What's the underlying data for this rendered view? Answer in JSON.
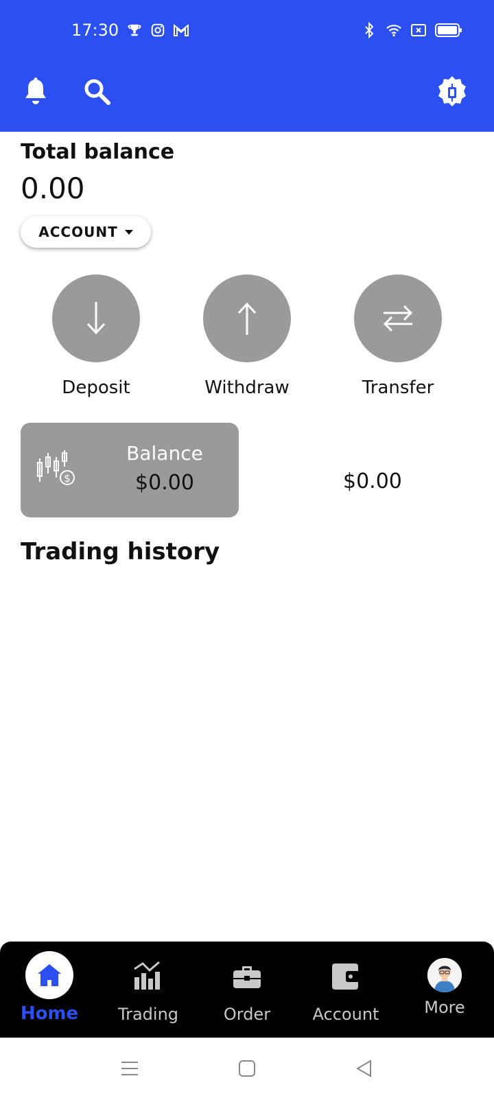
{
  "status_bar": {
    "time": "17:30",
    "left_icons": [
      "trophy-icon",
      "instagram-icon",
      "gmail-icon"
    ],
    "right_icons": [
      "bluetooth-icon",
      "wifi-icon",
      "sim-icon",
      "battery-icon"
    ]
  },
  "header": {
    "icons": [
      "bell-icon",
      "search-icon",
      "settings-icon"
    ],
    "color": "#2b4ff0"
  },
  "balance": {
    "label": "Total balance",
    "value": "0.00",
    "account_button": "ACCOUNT"
  },
  "actions": [
    {
      "label": "Deposit",
      "icon": "arrow-down-icon"
    },
    {
      "label": "Withdraw",
      "icon": "arrow-up-icon"
    },
    {
      "label": "Transfer",
      "icon": "transfer-icon"
    }
  ],
  "balance_card": {
    "label": "Balance",
    "value": "$0.00",
    "secondary_value": "$0.00"
  },
  "history": {
    "title": "Trading history"
  },
  "bottom_nav": {
    "items": [
      {
        "label": "Home",
        "icon": "home-icon",
        "active": true
      },
      {
        "label": "Trading",
        "icon": "chart-icon"
      },
      {
        "label": "Order",
        "icon": "briefcase-icon"
      },
      {
        "label": "Account",
        "icon": "wallet-icon"
      },
      {
        "label": "More",
        "icon": "avatar"
      }
    ]
  },
  "system_nav": [
    "menu-icon",
    "home-square-icon",
    "back-icon"
  ]
}
